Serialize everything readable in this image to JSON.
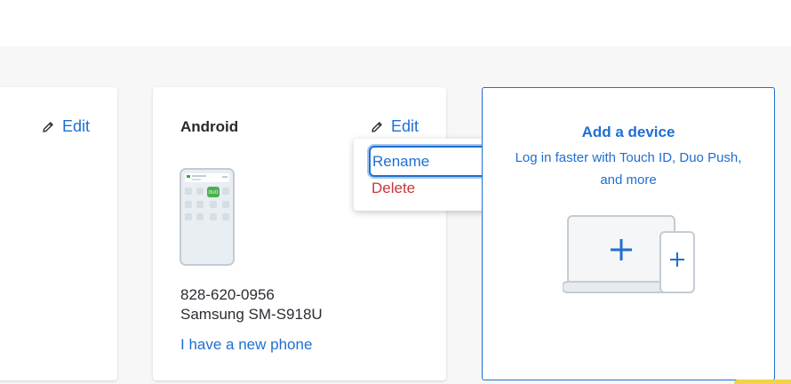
{
  "cards": {
    "left": {
      "edit_label": "Edit"
    },
    "android": {
      "title": "Android",
      "edit_label": "Edit",
      "phone_number": "828-620-0956",
      "model": "Samsung SM-S918U",
      "new_phone_link": "I have a new phone"
    },
    "add_device": {
      "title": "Add a device",
      "description": "Log in faster with Touch ID, Duo Push, and more"
    }
  },
  "edit_menu": {
    "rename_label": "Rename",
    "delete_label": "Delete"
  },
  "colors": {
    "accent": "#1f6fd1",
    "danger": "#c8363a",
    "background": "#f7f7f8"
  },
  "icons": [
    "pencil-icon",
    "phone-illustration",
    "plus-icon",
    "laptop-illustration"
  ]
}
